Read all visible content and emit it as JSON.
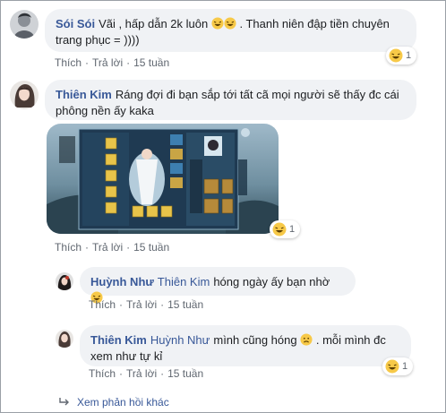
{
  "comments": [
    {
      "name": "Sói Sói",
      "text": "Vãi , hấp dẫn 2k luôn",
      "text2": ". Thanh niên đập tiền chuyên",
      "text3": "trang phục = ))))",
      "like": "Thích",
      "reply": "Trả lời",
      "time": "15 tuần",
      "reaction_count": "1"
    },
    {
      "name": "Thiên Kim",
      "text": "Ráng đợi đi bạn sắp tới tất cã mọi người sẽ thấy đc cái",
      "text2": "phông nền ấy kaka",
      "like": "Thích",
      "reply": "Trả lời",
      "time": "15 tuần",
      "reaction_count": "1"
    }
  ],
  "replies": [
    {
      "name": "Huỳnh Như",
      "mention": "Thiên Kim",
      "text": "hóng ngày ấy bạn nhờ",
      "like": "Thích",
      "reply": "Trả lời",
      "time": "15 tuần"
    },
    {
      "name": "Thiên Kim",
      "mention": "Huỳnh Như",
      "text": "mình cũng hóng",
      "text2": ". mỗi mình đc",
      "text3": "xem như tự kỉ",
      "like": "Thích",
      "reply": "Trả lời",
      "time": "15 tuần",
      "reaction_count": "1"
    }
  ],
  "more_replies": "Xem phản hồi khác",
  "icons": {
    "reaction": "laughing-emoji-icon",
    "reply_arrow": "reply-arrow-icon"
  },
  "colors": {
    "name_link": "#385898",
    "bubble": "#f0f2f5",
    "meta_text": "#606770"
  }
}
